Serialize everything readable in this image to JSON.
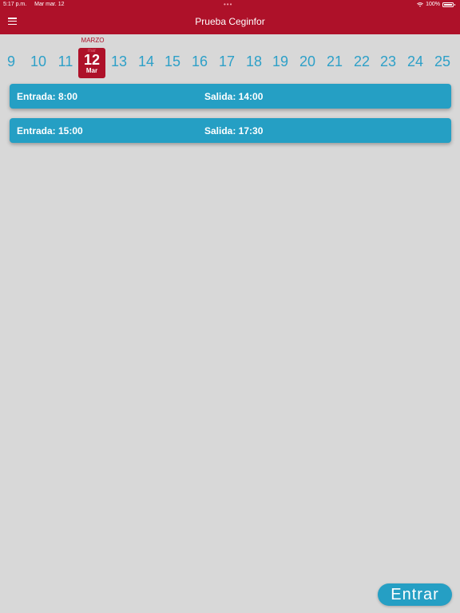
{
  "status_bar": {
    "time": "5:17 p.m.",
    "date": "Mar mar. 12",
    "dots": "•••",
    "battery": "100%"
  },
  "header": {
    "title": "Prueba Ceginfor"
  },
  "calendar": {
    "month": "MARZO",
    "selected": {
      "day": "12",
      "weekday": "Mar",
      "weekday_top": "mar"
    },
    "days_before": [
      "9",
      "10",
      "11"
    ],
    "days_after": [
      "13",
      "14",
      "15",
      "16",
      "17",
      "18",
      "19",
      "20",
      "21",
      "22",
      "23",
      "24",
      "25"
    ]
  },
  "shifts": [
    {
      "entrada": "Entrada: 8:00",
      "salida": "Salida: 14:00"
    },
    {
      "entrada": "Entrada: 15:00",
      "salida": "Salida: 17:30"
    }
  ],
  "actions": {
    "enter_label": "Entrar"
  },
  "colors": {
    "header": "#ae1129",
    "accent": "#259fc4",
    "background": "#d8d8d8"
  }
}
